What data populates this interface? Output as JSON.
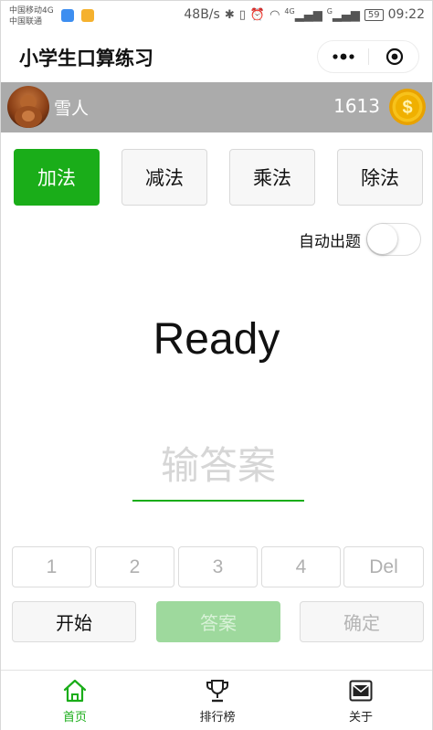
{
  "status_bar": {
    "carrier_line1": "中国移动4G",
    "carrier_line2": "中国联通",
    "net_speed": "48B/s",
    "signal_label_1": "4G",
    "signal_label_2": "G",
    "battery": "59",
    "time": "09:22"
  },
  "app": {
    "title": "小学生口算练习"
  },
  "user": {
    "name": "雪人",
    "score": "1613"
  },
  "operations": [
    {
      "label": "加法",
      "active": true
    },
    {
      "label": "减法",
      "active": false
    },
    {
      "label": "乘法",
      "active": false
    },
    {
      "label": "除法",
      "active": false
    }
  ],
  "auto_question": {
    "label": "自动出题",
    "enabled": false
  },
  "question": {
    "text": "Ready"
  },
  "answer_input": {
    "value": "",
    "placeholder": "输答案"
  },
  "keypad": [
    "1",
    "2",
    "3",
    "4",
    "Del"
  ],
  "actions": {
    "start": "开始",
    "answer": "答案",
    "confirm": "确定"
  },
  "tabs": [
    {
      "label": "首页",
      "icon": "home-icon",
      "active": true
    },
    {
      "label": "排行榜",
      "icon": "trophy-icon",
      "active": false
    },
    {
      "label": "关于",
      "icon": "mail-icon",
      "active": false
    }
  ],
  "colors": {
    "primary_green": "#1aad19",
    "answer_button_disabled": "#9ed99d",
    "user_bar_bg": "#ababab",
    "coin_gold": "#f5b800"
  }
}
